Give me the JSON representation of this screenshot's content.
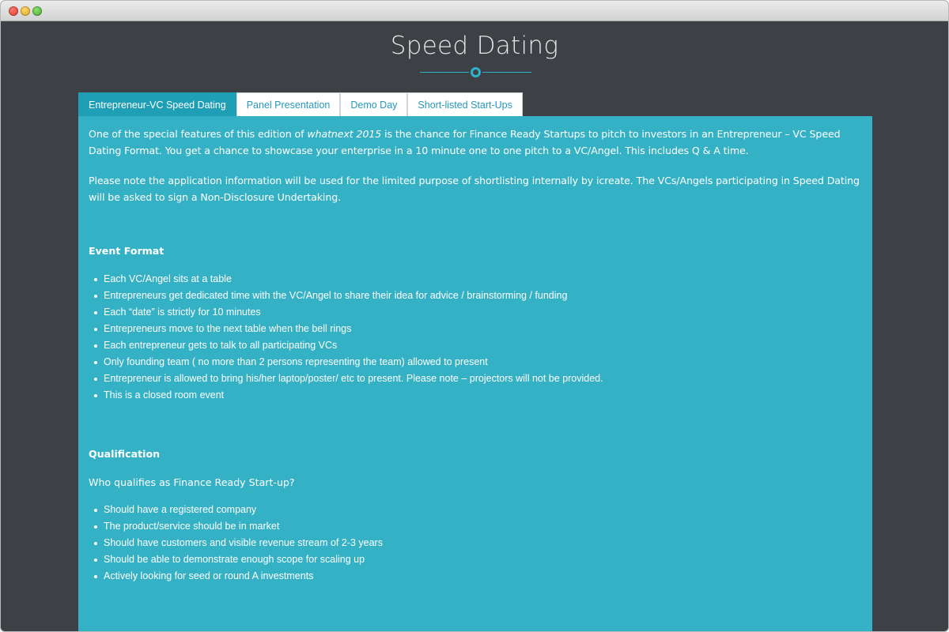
{
  "page": {
    "title": "Speed Dating"
  },
  "tabs": [
    {
      "label": "Entrepreneur-VC Speed Dating",
      "active": true
    },
    {
      "label": "Panel Presentation",
      "active": false
    },
    {
      "label": "Demo Day",
      "active": false
    },
    {
      "label": "Short-listed Start-Ups",
      "active": false
    }
  ],
  "content": {
    "intro_pre": "One of the special features of this edition of ",
    "intro_em": "whatnext 2015",
    "intro_post": " is the chance for Finance Ready Startups to pitch to investors in an Entrepreneur – VC Speed Dating Format. You get a chance to showcase your enterprise in a 10 minute one to one pitch to a VC/Angel. This includes Q & A time.",
    "note": "Please note the application information will be used for the limited purpose of shortlisting internally by icreate. The VCs/Angels participating in Speed Dating will be asked to sign a Non-Disclosure Undertaking.",
    "event_format": {
      "title": "Event Format",
      "items": [
        "Each VC/Angel sits at a table",
        "Entrepreneurs get dedicated time with the VC/Angel to share their idea for advice / brainstorming / funding",
        "Each “date” is strictly for 10 minutes",
        "Entrepreneurs move to the next table when the bell rings",
        "Each entrepreneur gets to talk to all participating VCs",
        "Only founding team ( no more than 2 persons representing the team) allowed to present",
        "Entrepreneur is allowed to bring his/her laptop/poster/ etc to present. Please note – projectors will not be provided.",
        "This is a closed room event"
      ]
    },
    "qualification": {
      "title": "Qualification",
      "question": "Who qualifies as Finance Ready Start-up?",
      "items": [
        "Should have a registered company",
        "The product/service should be in market",
        "Should have customers and visible revenue stream of 2-3 years",
        "Should be able to demonstrate enough scope for scaling up",
        "Actively looking for seed or round A investments"
      ]
    }
  },
  "colors": {
    "background": "#3d4045",
    "accent": "#2eb3c8",
    "panel": "#35b1c6",
    "active_tab": "#1e9fb6"
  }
}
